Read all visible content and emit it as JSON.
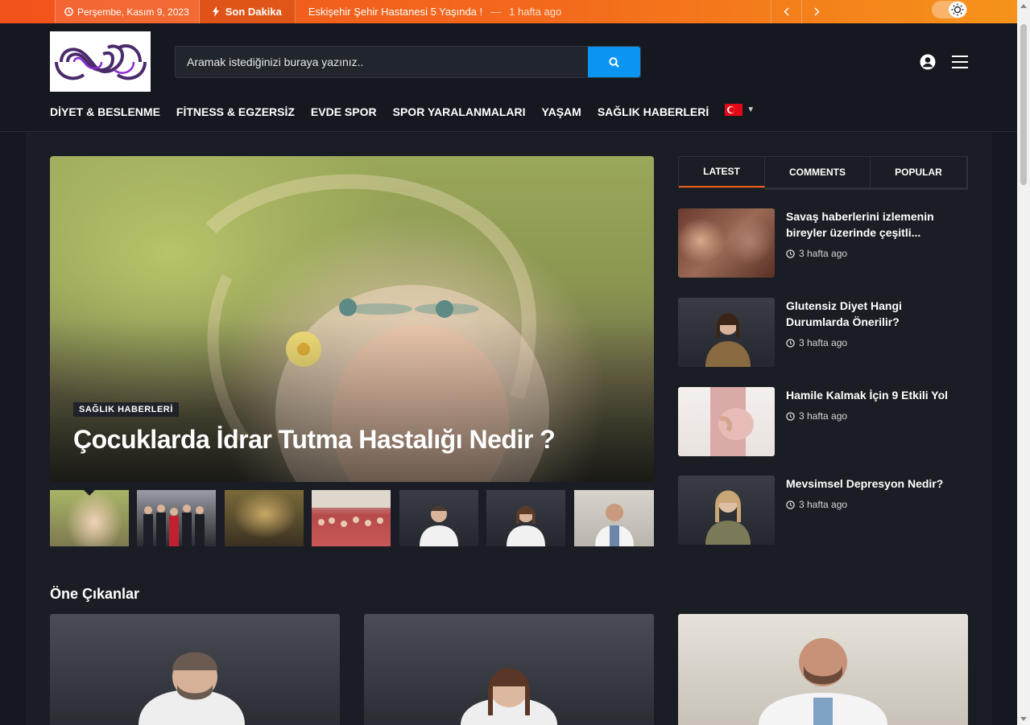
{
  "topbar": {
    "date": "Perşembe, Kasım 9, 2023",
    "breaking_label": "Son Dakika",
    "breaking_title": "Eskişehir Şehir Hastanesi 5 Yaşında !",
    "breaking_dash": "—",
    "breaking_time": "1 hafta ago",
    "prev_icon": "chevron-left-icon",
    "next_icon": "chevron-right-icon",
    "mode_toggle_icon": "sun-icon"
  },
  "header": {
    "search_placeholder": "Aramak istediğinizi buraya yazınız..",
    "search_icon": "search-icon",
    "user_icon": "user-circle-icon",
    "menu_icon": "hamburger-icon"
  },
  "nav": {
    "items": [
      "DİYET & BESLENME",
      "FİTNESS & EGZERSİZ",
      "EVDE SPOR",
      "SPOR YARALANMALARI",
      "YAŞAM",
      "SAĞLIK HABERLERİ"
    ],
    "language_icon": "turkey-flag-icon"
  },
  "hero": {
    "category": "SAĞLIK HABERLERİ",
    "title": "Çocuklarda İdrar Tutma Hastalığı Nedir ?"
  },
  "sidebar": {
    "tabs": [
      "LATEST",
      "COMMENTS",
      "POPULAR"
    ],
    "active_tab": "LATEST",
    "items": [
      {
        "title": "Savaş haberlerini izlemenin bireyler üzerinde çeşitli...",
        "time": "3 hafta ago"
      },
      {
        "title": "Glutensiz Diyet Hangi Durumlarda Önerilir?",
        "time": "3 hafta ago"
      },
      {
        "title": "Hamile Kalmak İçin 9 Etkili Yol",
        "time": "3 hafta ago"
      },
      {
        "title": "Mevsimsel Depresyon Nedir?",
        "time": "3 hafta ago"
      }
    ]
  },
  "featured": {
    "section_title": "Öne Çıkanlar"
  },
  "colors": {
    "accent": "#f25a1c",
    "search_button": "#0a95f3",
    "background": "#15181e"
  }
}
